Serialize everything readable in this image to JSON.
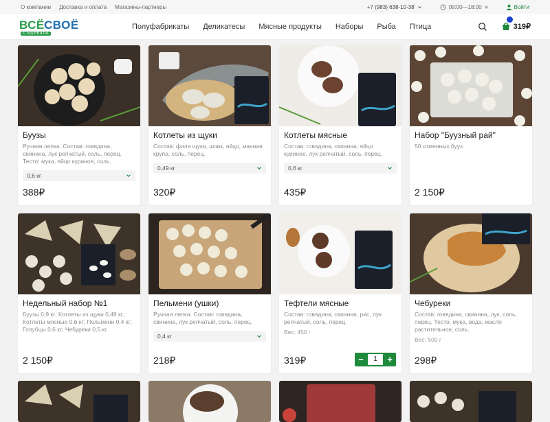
{
  "topbar": {
    "links": [
      "О компании",
      "Доставка и оплата",
      "Магазины-партнеры"
    ],
    "phone": "+7 (983) 638-10-38",
    "hours": "09:00—18:00",
    "login": "Войти"
  },
  "header": {
    "logo_word1": "ВСЁ",
    "logo_word2": "СВОЁ",
    "logo_sub": "С БАЙКАЛА",
    "nav": [
      "Полуфабрикаты",
      "Деликатесы",
      "Мясные продукты",
      "Наборы",
      "Рыба",
      "Птица"
    ],
    "cart_total": "319₽"
  },
  "products": [
    {
      "name": "Буузы",
      "desc": "Ручная лепка. Состав: говядина, свинина, лук репчатый, соль, перец. Тесто: мука, яйцо куриное, соль.",
      "select": "0,6 кг",
      "price": "388₽"
    },
    {
      "name": "Котлеты из щуки",
      "desc": "Состав: филе щуки, шпик, яйцо, манная крупа, соль, перец.",
      "select": "0,49 кг",
      "price": "320₽"
    },
    {
      "name": "Котлеты мясные",
      "desc": "Состав: говядина, свинина, яйцо куриное, лук репчатый, соль, перец.",
      "select": "0,6 кг",
      "price": "435₽"
    },
    {
      "name": "Набор \"Буузный рай\"",
      "desc": "50 отменных бууз",
      "price": "2 150₽"
    },
    {
      "name": "Недельный набор №1",
      "desc": "Буузы 0,9 кг; Котлеты из щуки 0,49 кг; Котлеты мясные 0,6 кг; Пельмени 0,4 кг; Голубцы 0,6 кг; Чебуреки 0,5 кг.",
      "price": "2 150₽"
    },
    {
      "name": "Пельмени (ушки)",
      "desc": "Ручная лепка. Состав: говядина, свинина, лук репчатый, соль, перец.",
      "select": "0,4 кг",
      "price": "218₽"
    },
    {
      "name": "Тефтели мясные",
      "desc": "Состав: говядина, свинина, рис, лук репчатый, соль, перец.",
      "weight": "Вес: 450 г",
      "price": "319₽",
      "qty": "1"
    },
    {
      "name": "Чебуреки",
      "desc": "Состав: говядина, свинина, лук, соль, перец. Тесто: мука, вода, масло растительное, соль.",
      "weight": "Вес: 500 г",
      "price": "298₽"
    }
  ],
  "colors": {
    "accent": "#1e8a3c",
    "logo_green": "#2a9d4a",
    "logo_blue": "#1f6fb2",
    "badge": "#1a3fd1"
  }
}
